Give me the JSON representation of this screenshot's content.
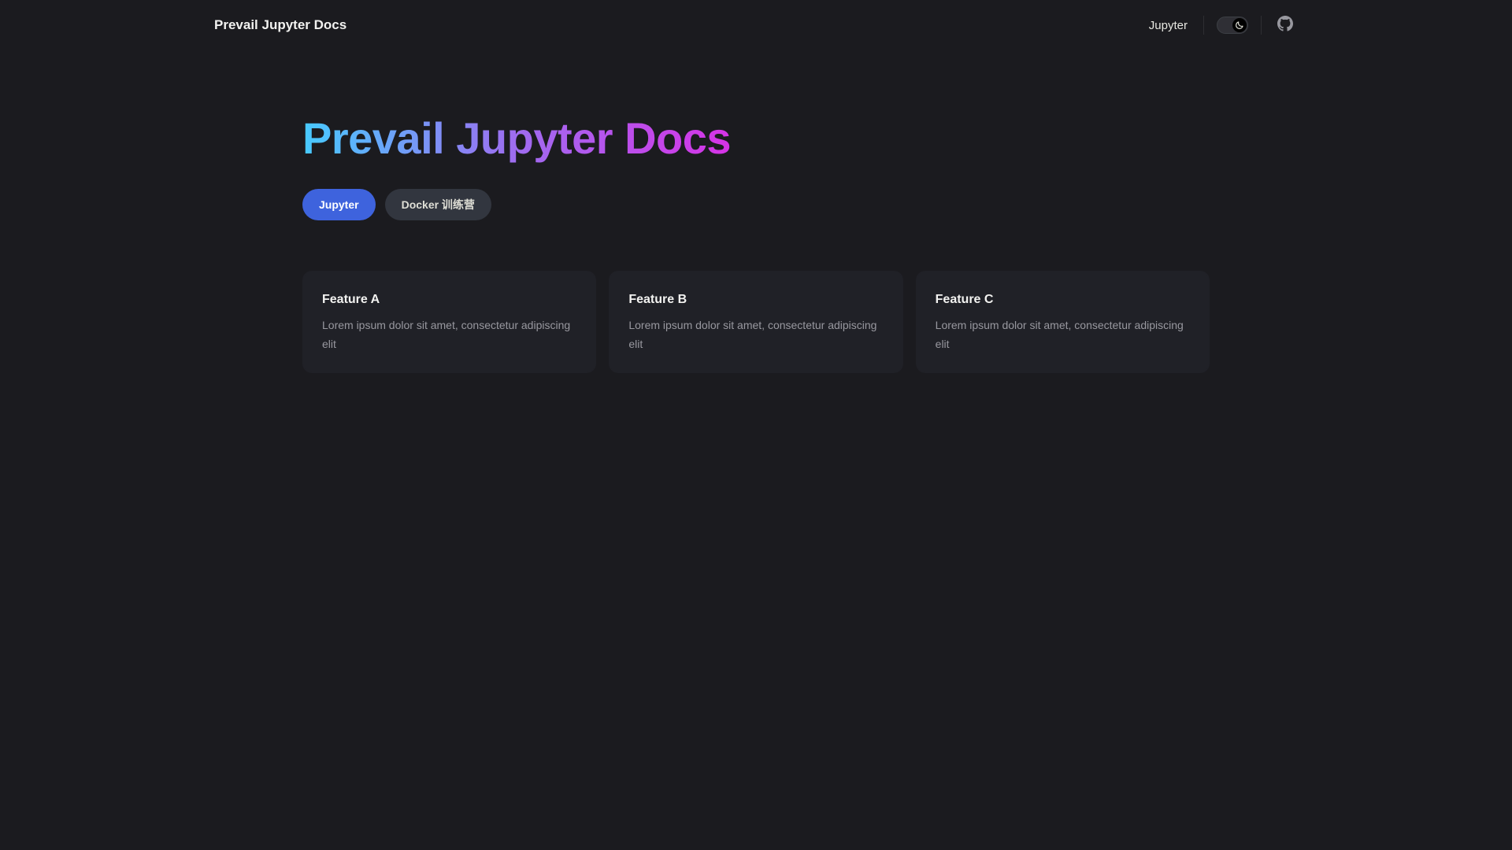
{
  "colors": {
    "background": "#1b1b1f",
    "card_background": "#202127",
    "brand_button": "#3e63dd",
    "alt_button": "#32363f",
    "title_gradient": [
      "#47caff",
      "#9f6cf0",
      "#d633e6"
    ]
  },
  "navbar": {
    "site_title": "Prevail Jupyter Docs",
    "links": [
      {
        "label": "Jupyter"
      }
    ],
    "theme_toggle": {
      "icon": "moon-icon",
      "state": "dark"
    },
    "social": {
      "icon": "github-icon"
    }
  },
  "hero": {
    "name": "Prevail Jupyter Docs",
    "actions": [
      {
        "label": "Jupyter",
        "theme": "brand"
      },
      {
        "label": "Docker 训练营",
        "theme": "alt"
      }
    ]
  },
  "features": [
    {
      "title": "Feature A",
      "details": "Lorem ipsum dolor sit amet, consectetur adipiscing elit"
    },
    {
      "title": "Feature B",
      "details": "Lorem ipsum dolor sit amet, consectetur adipiscing elit"
    },
    {
      "title": "Feature C",
      "details": "Lorem ipsum dolor sit amet, consectetur adipiscing elit"
    }
  ]
}
